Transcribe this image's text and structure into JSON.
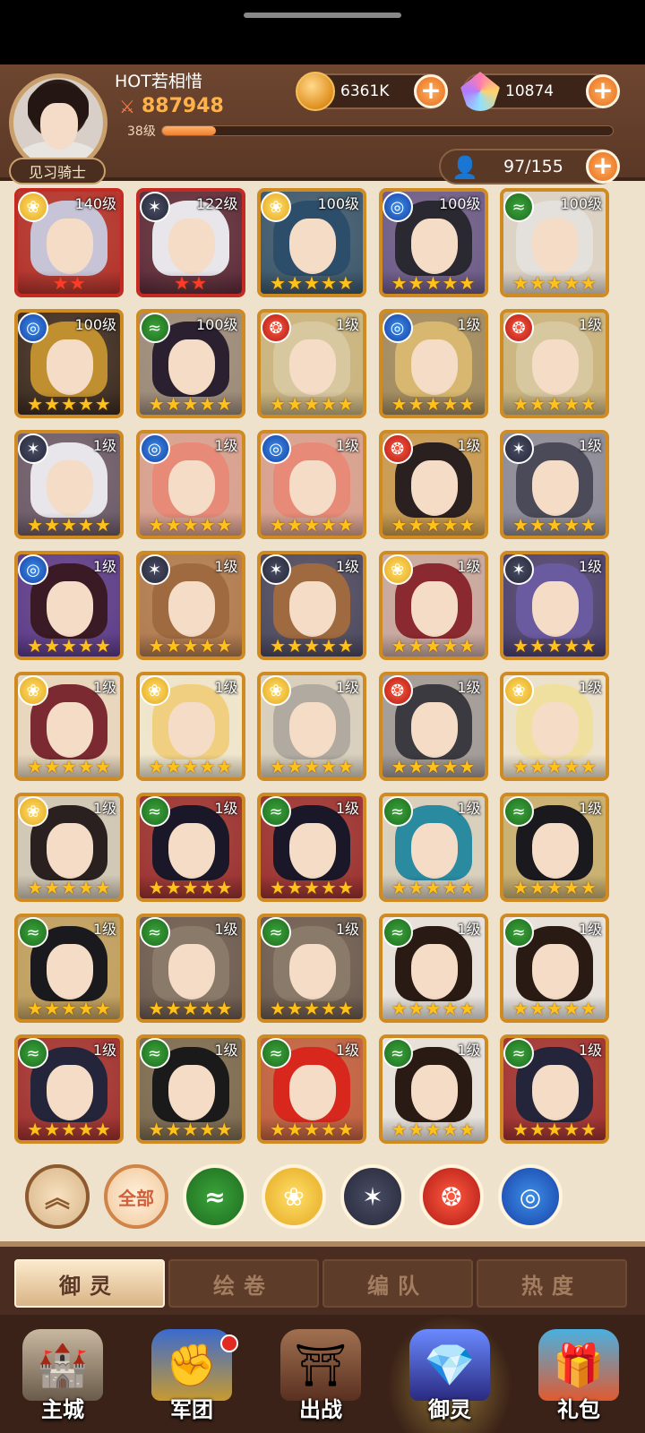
{
  "player": {
    "name": "HOT若相惜",
    "power": "887948",
    "level": "38级",
    "rank": "见习骑士",
    "xp_fraction": 0.12
  },
  "resources": {
    "gold": "6361K",
    "gems": "10874",
    "roster": "97/155"
  },
  "icons": {
    "power": "crossed-swords-icon",
    "gold": "gold-coin-icon",
    "gems": "crystal-gem-icon",
    "roster": "person-icon",
    "plus": "plus-icon"
  },
  "elements": {
    "wind": "#2e8f2e",
    "light": "#e8b020",
    "dark": "#3a3c50",
    "fire": "#c8281e",
    "water": "#2a5fd0"
  },
  "heroes": [
    {
      "level": "140级",
      "element": "light",
      "stars": 2,
      "star_color": "red",
      "frame": "red",
      "hair": "#c8c4d8",
      "bg": "#b2302a"
    },
    {
      "level": "122级",
      "element": "dark",
      "stars": 2,
      "star_color": "red",
      "frame": "red",
      "hair": "#e8e6ea",
      "bg": "#5c2a3a"
    },
    {
      "level": "100级",
      "element": "light",
      "stars": 5,
      "star_color": "gold",
      "frame": "gold",
      "hair": "#2d4e6a",
      "bg": "#39576e"
    },
    {
      "level": "100级",
      "element": "water",
      "stars": 5,
      "star_color": "gold",
      "frame": "gold",
      "hair": "#2a2830",
      "bg": "#6a5a8a"
    },
    {
      "level": "100级",
      "element": "wind",
      "stars": 5,
      "star_color": "gold",
      "frame": "gold",
      "hair": "#e4e0dc",
      "bg": "#dcd4c8"
    },
    {
      "level": "100级",
      "element": "water",
      "stars": 5,
      "star_color": "gold",
      "frame": "gold",
      "hair": "#c09030",
      "bg": "#3a2a20"
    },
    {
      "level": "100级",
      "element": "wind",
      "stars": 5,
      "star_color": "gold",
      "frame": "gold",
      "hair": "#2a2030",
      "bg": "#9a8a7a"
    },
    {
      "level": "1级",
      "element": "fire",
      "stars": 5,
      "star_color": "gold",
      "frame": "gold",
      "hair": "#d8c8a0",
      "bg": "#c9b580"
    },
    {
      "level": "1级",
      "element": "water",
      "stars": 5,
      "star_color": "gold",
      "frame": "gold",
      "hair": "#d8b870",
      "bg": "#a08a60"
    },
    {
      "level": "1级",
      "element": "fire",
      "stars": 5,
      "star_color": "gold",
      "frame": "gold",
      "hair": "#d8c8a0",
      "bg": "#c9b580"
    },
    {
      "level": "1级",
      "element": "dark",
      "stars": 5,
      "star_color": "gold",
      "frame": "gold",
      "hair": "#e8e6ea",
      "bg": "#6a5a6a"
    },
    {
      "level": "1级",
      "element": "water",
      "stars": 5,
      "star_color": "gold",
      "frame": "gold",
      "hair": "#e88a78",
      "bg": "#d8a090"
    },
    {
      "level": "1级",
      "element": "water",
      "stars": 5,
      "star_color": "gold",
      "frame": "gold",
      "hair": "#e88a78",
      "bg": "#d8a090"
    },
    {
      "level": "1级",
      "element": "fire",
      "stars": 5,
      "star_color": "gold",
      "frame": "gold",
      "hair": "#2a2020",
      "bg": "#c89a50"
    },
    {
      "level": "1级",
      "element": "dark",
      "stars": 5,
      "star_color": "gold",
      "frame": "gold",
      "hair": "#4a4a58",
      "bg": "#8a8a9a"
    },
    {
      "level": "1级",
      "element": "water",
      "stars": 5,
      "star_color": "gold",
      "frame": "gold",
      "hair": "#3a1a24",
      "bg": "#5a3a8a"
    },
    {
      "level": "1级",
      "element": "dark",
      "stars": 5,
      "star_color": "gold",
      "frame": "gold",
      "hair": "#a06a40",
      "bg": "#b07a50"
    },
    {
      "level": "1级",
      "element": "dark",
      "stars": 5,
      "star_color": "gold",
      "frame": "gold",
      "hair": "#a06a40",
      "bg": "#4a4860"
    },
    {
      "level": "1级",
      "element": "light",
      "stars": 5,
      "star_color": "gold",
      "frame": "gold",
      "hair": "#8a2a30",
      "bg": "#c8a8a0"
    },
    {
      "level": "1级",
      "element": "dark",
      "stars": 5,
      "star_color": "gold",
      "frame": "gold",
      "hair": "#6a5aa0",
      "bg": "#4a4070"
    },
    {
      "level": "1级",
      "element": "light",
      "stars": 5,
      "star_color": "gold",
      "frame": "gold",
      "hair": "#7a2a30",
      "bg": "#e8d8c0"
    },
    {
      "level": "1级",
      "element": "light",
      "stars": 5,
      "star_color": "gold",
      "frame": "gold",
      "hair": "#f0d080",
      "bg": "#f0e8d0"
    },
    {
      "level": "1级",
      "element": "light",
      "stars": 5,
      "star_color": "gold",
      "frame": "gold",
      "hair": "#b0aaa0",
      "bg": "#d8d0c0"
    },
    {
      "level": "1级",
      "element": "fire",
      "stars": 5,
      "star_color": "gold",
      "frame": "gold",
      "hair": "#3a3a40",
      "bg": "#a09a98"
    },
    {
      "level": "1级",
      "element": "light",
      "stars": 5,
      "star_color": "gold",
      "frame": "gold",
      "hair": "#f0e0a0",
      "bg": "#ede4d0"
    },
    {
      "level": "1级",
      "element": "light",
      "stars": 5,
      "star_color": "gold",
      "frame": "gold",
      "hair": "#2a2020",
      "bg": "#d0c8b8"
    },
    {
      "level": "1级",
      "element": "wind",
      "stars": 5,
      "star_color": "gold",
      "frame": "gold",
      "hair": "#1a1828",
      "bg": "#9a3030"
    },
    {
      "level": "1级",
      "element": "wind",
      "stars": 5,
      "star_color": "gold",
      "frame": "gold",
      "hair": "#1a1828",
      "bg": "#9a3030"
    },
    {
      "level": "1级",
      "element": "wind",
      "stars": 5,
      "star_color": "gold",
      "frame": "gold",
      "hair": "#2a8aa0",
      "bg": "#d8d0c0"
    },
    {
      "level": "1级",
      "element": "wind",
      "stars": 5,
      "star_color": "gold",
      "frame": "gold",
      "hair": "#1a1a1e",
      "bg": "#c8b070"
    },
    {
      "level": "1级",
      "element": "wind",
      "stars": 5,
      "star_color": "gold",
      "frame": "gold",
      "hair": "#1a1a1e",
      "bg": "#c0a060"
    },
    {
      "level": "1级",
      "element": "wind",
      "stars": 5,
      "star_color": "gold",
      "frame": "gold",
      "hair": "#8a7a6a",
      "bg": "#6a5a50"
    },
    {
      "level": "1级",
      "element": "wind",
      "stars": 5,
      "star_color": "gold",
      "frame": "gold",
      "hair": "#8a7a6a",
      "bg": "#6a5a50"
    },
    {
      "level": "1级",
      "element": "wind",
      "stars": 5,
      "star_color": "gold",
      "frame": "gold",
      "hair": "#2a1a14",
      "bg": "#e8e4e0"
    },
    {
      "level": "1级",
      "element": "wind",
      "stars": 5,
      "star_color": "gold",
      "frame": "gold",
      "hair": "#2a1a14",
      "bg": "#e8e4e0"
    },
    {
      "level": "1级",
      "element": "wind",
      "stars": 5,
      "star_color": "gold",
      "frame": "gold",
      "hair": "#24243a",
      "bg": "#a03030"
    },
    {
      "level": "1级",
      "element": "wind",
      "stars": 5,
      "star_color": "gold",
      "frame": "gold",
      "hair": "#1a1a1a",
      "bg": "#7a6a50"
    },
    {
      "level": "1级",
      "element": "wind",
      "stars": 5,
      "star_color": "gold",
      "frame": "gold",
      "hair": "#d8281e",
      "bg": "#c06040"
    },
    {
      "level": "1级",
      "element": "wind",
      "stars": 5,
      "star_color": "gold",
      "frame": "gold",
      "hair": "#2a1a14",
      "bg": "#e8e4e0"
    },
    {
      "level": "1级",
      "element": "wind",
      "stars": 5,
      "star_color": "gold",
      "frame": "gold",
      "hair": "#24243a",
      "bg": "#a03030"
    }
  ],
  "filters": {
    "all_label": "全部",
    "items": [
      "collapse",
      "all",
      "wind",
      "light",
      "dark",
      "fire",
      "water"
    ]
  },
  "tabs": [
    {
      "label": "御灵",
      "active": true
    },
    {
      "label": "绘卷",
      "active": false
    },
    {
      "label": "编队",
      "active": false
    },
    {
      "label": "热度",
      "active": false
    }
  ],
  "nav": [
    {
      "label": "主城",
      "icon": "castle-icon",
      "active": false
    },
    {
      "label": "军团",
      "icon": "guild-fist-icon",
      "active": false,
      "badge": true
    },
    {
      "label": "出战",
      "icon": "battle-gate-icon",
      "active": false
    },
    {
      "label": "御灵",
      "icon": "crystal-icon",
      "active": true
    },
    {
      "label": "礼包",
      "icon": "gift-shop-icon",
      "active": false
    }
  ]
}
